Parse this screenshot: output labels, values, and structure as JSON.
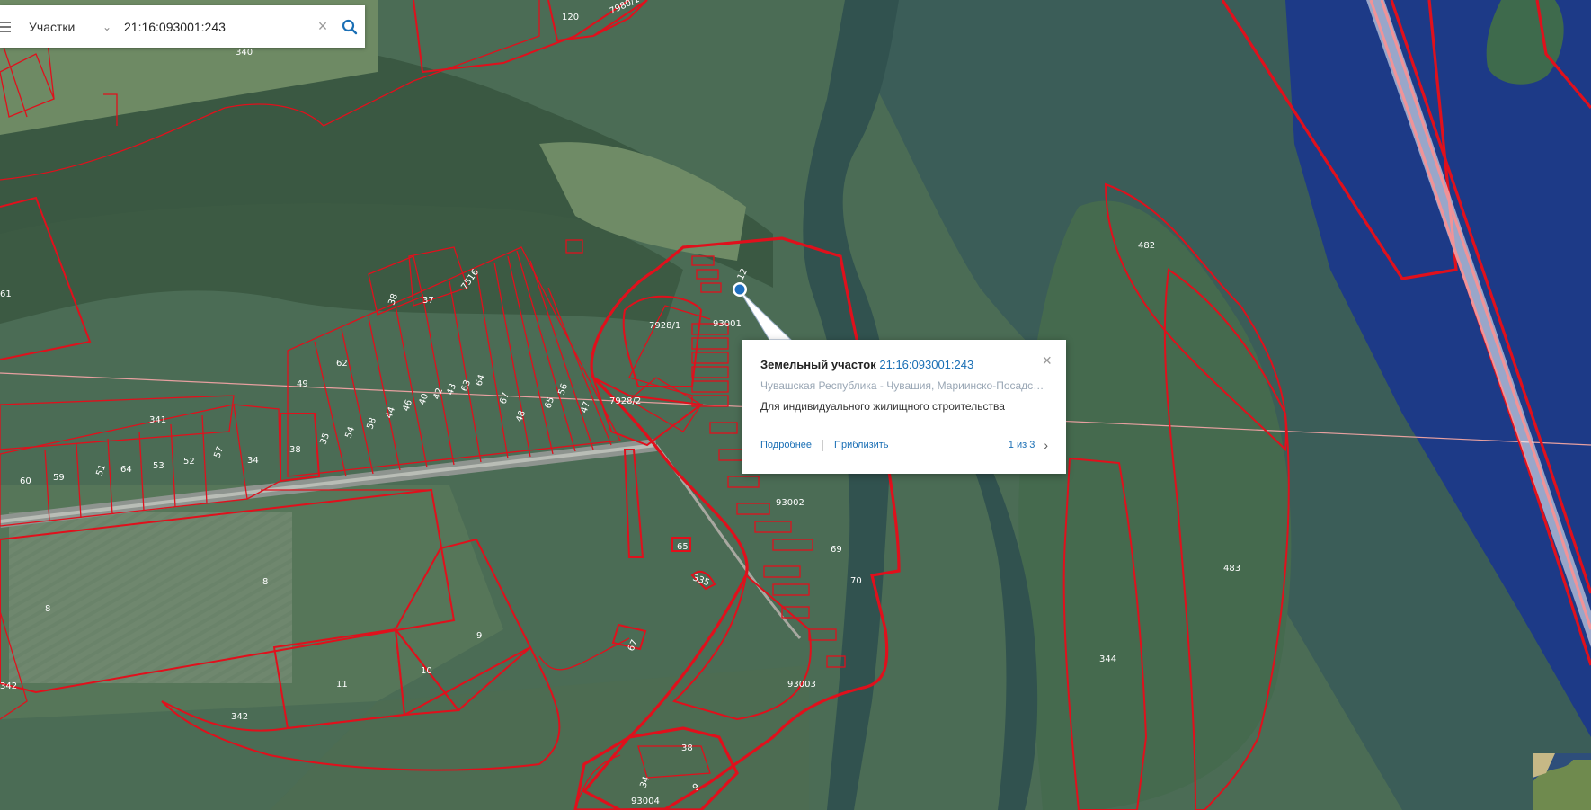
{
  "search": {
    "type_label": "Участки",
    "query": "21:16:093001:243"
  },
  "popup": {
    "heading": "Земельный участок",
    "cadastral_number": "21:16:093001:243",
    "region": "Чувашская Республика - Чувашия, Мариинско-Посадский",
    "purpose": "Для индивидуального жилищного строительства",
    "more_link": "Подробнее",
    "zoom_link": "Приблизить",
    "page_counter": "1 из 3"
  },
  "parcel_labels": [
    "120",
    "7980/1",
    "340",
    "37",
    "38",
    "7516",
    "62",
    "49",
    "341",
    "60",
    "59",
    "64",
    "53",
    "52",
    "57",
    "34",
    "38",
    "35",
    "54",
    "58",
    "44",
    "46",
    "40",
    "42",
    "43",
    "63",
    "64",
    "67",
    "48",
    "65",
    "56",
    "47",
    "51",
    "61",
    "12",
    "7928/1",
    "93001",
    "7928/2",
    "93002",
    "69",
    "70",
    "65",
    "335",
    "67",
    "8",
    "8",
    "9",
    "10",
    "11",
    "342",
    "342",
    "38",
    "93003",
    "34",
    "93004",
    "9",
    "482",
    "483",
    "344"
  ],
  "colors": {
    "parcel_border": "#e0101c",
    "river": "#1a3a8a",
    "satellite_forest": "#3d5e45",
    "link": "#1a6fb5"
  },
  "icons": [
    "menu-icon",
    "chevron-down-icon",
    "clear-icon",
    "search-icon",
    "location-pin-icon",
    "close-icon",
    "chevron-right-icon"
  ]
}
